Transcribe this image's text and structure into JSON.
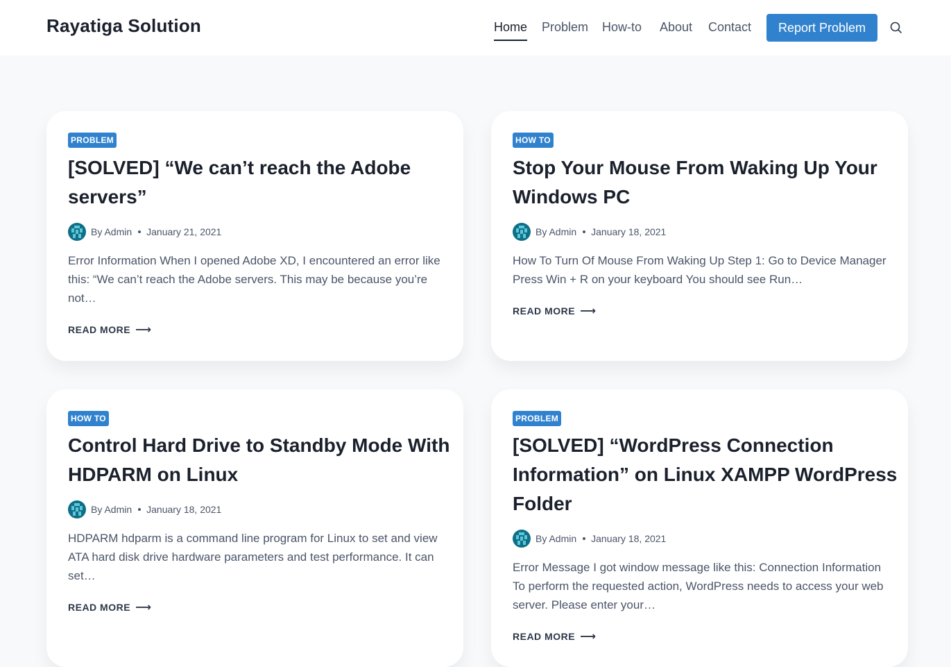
{
  "header": {
    "brand": "Rayatiga Solution",
    "nav": [
      {
        "label": "Home",
        "active": true
      },
      {
        "label": "Problem",
        "active": false
      },
      {
        "label": "How-to",
        "active": false
      },
      {
        "label": "About",
        "active": false
      },
      {
        "label": "Contact",
        "active": false
      }
    ],
    "cta_label": "Report Problem",
    "search_icon": "search-icon"
  },
  "colors": {
    "accent": "#3182ce",
    "text": "#1a202c",
    "muted": "#4a5568",
    "background": "#f7f9fb"
  },
  "posts": [
    {
      "category": "PROBLEM",
      "title": "[SOLVED] “We can’t reach the Adobe servers”",
      "author": "By Admin",
      "date": "January 21, 2021",
      "excerpt": "Error Information When I opened Adobe XD, I encountered an error like this: “We can’t reach the Adobe servers. This may be because you’re not…",
      "read_more": "READ MORE",
      "arrow": "⟶"
    },
    {
      "category": "HOW TO",
      "title": "Stop Your Mouse From Waking Up Your Windows PC",
      "author": "By Admin",
      "date": "January 18, 2021",
      "excerpt": "How To Turn Of Mouse From Waking Up Step 1: Go to Device Manager Press Win + R on your keyboard You should see Run…",
      "read_more": "READ MORE",
      "arrow": "⟶"
    },
    {
      "category": "HOW TO",
      "title": "Control Hard Drive to Standby Mode With HDPARM on Linux",
      "author": "By Admin",
      "date": "January 18, 2021",
      "excerpt": "HDPARM hdparm is a command line program for Linux to set and view ATA hard disk drive hardware parameters and test performance. It can set…",
      "read_more": "READ MORE",
      "arrow": "⟶"
    },
    {
      "category": "PROBLEM",
      "title": "[SOLVED] “WordPress Connection Information” on Linux XAMPP WordPress Folder",
      "author": "By Admin",
      "date": "January 18, 2021",
      "excerpt": "Error Message I got window message like this: Connection Information To perform the requested action, WordPress needs to access your web server. Please enter your…",
      "read_more": "READ MORE",
      "arrow": "⟶"
    }
  ]
}
